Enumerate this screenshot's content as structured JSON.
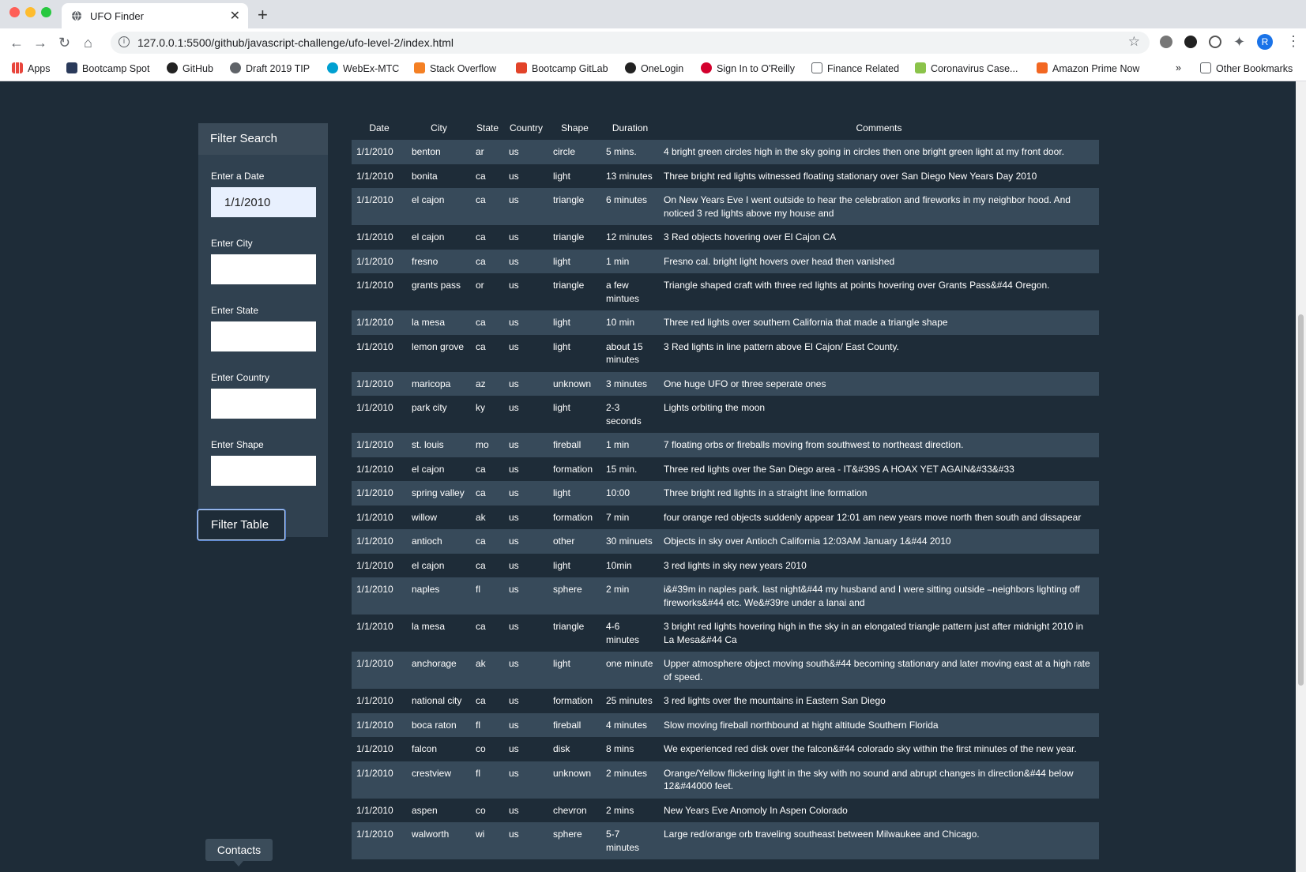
{
  "browser": {
    "tab_title": "UFO Finder",
    "url": "127.0.0.1:5500/github/javascript-challenge/ufo-level-2/index.html",
    "profile_initial": "R",
    "bookmarks": [
      "Apps",
      "Bootcamp Spot",
      "GitHub",
      "Draft 2019 TIP",
      "WebEx-MTC",
      "Stack Overflow",
      "Bootcamp GitLab",
      "OneLogin",
      "Sign In to O'Reilly",
      "Finance Related",
      "Coronavirus Case...",
      "Amazon Prime Now",
      "Other Bookmarks"
    ],
    "more_bookmarks": "»"
  },
  "filter": {
    "title": "Filter Search",
    "date_label": "Enter a Date",
    "date_value": "1/1/2010",
    "city_label": "Enter City",
    "state_label": "Enter State",
    "country_label": "Enter Country",
    "shape_label": "Enter Shape",
    "button_label": "Filter Table"
  },
  "table": {
    "headers": [
      "Date",
      "City",
      "State",
      "Country",
      "Shape",
      "Duration",
      "Comments"
    ],
    "rows": [
      [
        "1/1/2010",
        "benton",
        "ar",
        "us",
        "circle",
        "5 mins.",
        "4 bright green circles high in the sky going in circles then one bright green light at my front door."
      ],
      [
        "1/1/2010",
        "bonita",
        "ca",
        "us",
        "light",
        "13 minutes",
        "Three bright red lights witnessed floating stationary over San Diego New Years Day 2010"
      ],
      [
        "1/1/2010",
        "el cajon",
        "ca",
        "us",
        "triangle",
        "6 minutes",
        "On New Years Eve I went outside to hear the celebration and fireworks in my neighbor hood. And noticed 3 red lights above my house and"
      ],
      [
        "1/1/2010",
        "el cajon",
        "ca",
        "us",
        "triangle",
        "12 minutes",
        "3 Red objects hovering over El Cajon CA"
      ],
      [
        "1/1/2010",
        "fresno",
        "ca",
        "us",
        "light",
        "1 min",
        "Fresno cal. bright light hovers over head then vanished"
      ],
      [
        "1/1/2010",
        "grants pass",
        "or",
        "us",
        "triangle",
        "a few mintues",
        "Triangle shaped craft with three red lights at points hovering over Grants Pass&#44 Oregon."
      ],
      [
        "1/1/2010",
        "la mesa",
        "ca",
        "us",
        "light",
        "10 min",
        "Three red lights over southern California that made a triangle shape"
      ],
      [
        "1/1/2010",
        "lemon grove",
        "ca",
        "us",
        "light",
        "about 15 minutes",
        "3 Red lights in line pattern above El Cajon/ East County."
      ],
      [
        "1/1/2010",
        "maricopa",
        "az",
        "us",
        "unknown",
        "3 minutes",
        "One huge UFO or three seperate ones"
      ],
      [
        "1/1/2010",
        "park city",
        "ky",
        "us",
        "light",
        "2-3 seconds",
        "Lights orbiting the moon"
      ],
      [
        "1/1/2010",
        "st. louis",
        "mo",
        "us",
        "fireball",
        "1 min",
        "7 floating orbs or fireballs moving from southwest to northeast direction."
      ],
      [
        "1/1/2010",
        "el cajon",
        "ca",
        "us",
        "formation",
        "15 min.",
        "Three red lights over the San Diego area - IT&#39S A HOAX YET AGAIN&#33&#33"
      ],
      [
        "1/1/2010",
        "spring valley",
        "ca",
        "us",
        "light",
        "10:00",
        "Three bright red lights in a straight line formation"
      ],
      [
        "1/1/2010",
        "willow",
        "ak",
        "us",
        "formation",
        "7 min",
        "four orange red objects suddenly appear 12:01 am new years move north then south and dissapear"
      ],
      [
        "1/1/2010",
        "antioch",
        "ca",
        "us",
        "other",
        "30 minuets",
        "Objects in sky over Antioch California 12:03AM January 1&#44 2010"
      ],
      [
        "1/1/2010",
        "el cajon",
        "ca",
        "us",
        "light",
        "10min",
        "3 red lights in sky new years 2010"
      ],
      [
        "1/1/2010",
        "naples",
        "fl",
        "us",
        "sphere",
        "2 min",
        "i&#39m in naples park. last night&#44 my husband and I were sitting outside –neighbors lighting off fireworks&#44 etc. We&#39re under a lanai and"
      ],
      [
        "1/1/2010",
        "la mesa",
        "ca",
        "us",
        "triangle",
        "4-6 minutes",
        "3 bright red lights hovering high in the sky in an elongated triangle pattern just after midnight 2010 in La Mesa&#44 Ca"
      ],
      [
        "1/1/2010",
        "anchorage",
        "ak",
        "us",
        "light",
        "one minute",
        "Upper atmosphere object moving south&#44 becoming stationary and later moving east at a high rate of speed."
      ],
      [
        "1/1/2010",
        "national city",
        "ca",
        "us",
        "formation",
        "25 minutes",
        "3 red lights over the mountains in Eastern San Diego"
      ],
      [
        "1/1/2010",
        "boca raton",
        "fl",
        "us",
        "fireball",
        "4 minutes",
        "Slow moving fireball northbound at hight altitude Southern Florida"
      ],
      [
        "1/1/2010",
        "falcon",
        "co",
        "us",
        "disk",
        "8 mins",
        "We experienced red disk over the falcon&#44 colorado sky within the first minutes of the new year."
      ],
      [
        "1/1/2010",
        "crestview",
        "fl",
        "us",
        "unknown",
        "2 minutes",
        "Orange/Yellow flickering light in the sky with no sound and abrupt changes in direction&#44 below 12&#44000 feet."
      ],
      [
        "1/1/2010",
        "aspen",
        "co",
        "us",
        "chevron",
        "2 mins",
        "New Years Eve Anomoly In Aspen Colorado"
      ],
      [
        "1/1/2010",
        "walworth",
        "wi",
        "us",
        "sphere",
        "5-7 minutes",
        "Large red/orange orb traveling southeast between Milwaukee and Chicago."
      ]
    ]
  },
  "contacts_label": "Contacts",
  "colors": {
    "page_bg": "#1e2c38",
    "panel_bg": "#304150",
    "row_stripe": "#374a5a"
  }
}
